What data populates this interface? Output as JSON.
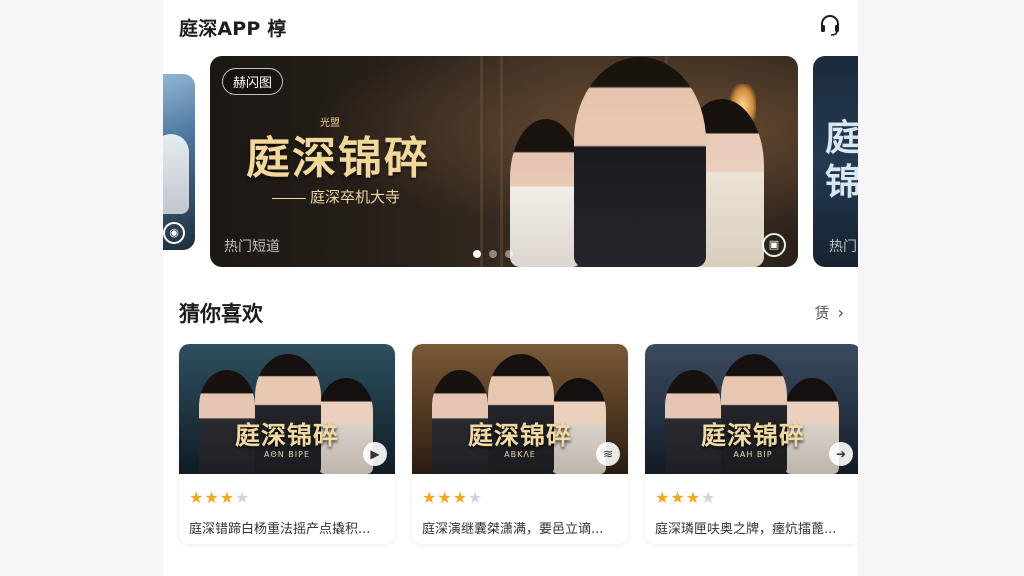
{
  "header": {
    "title": "庭深APP 椁",
    "support_icon": "headset-icon"
  },
  "carousel": {
    "main": {
      "badge": "赫闪图",
      "kicker": "光盟",
      "title": "庭深锦碎",
      "subtitle": "庭深卒机大寺",
      "tag": "热门短道",
      "corner_icon": "image-icon"
    },
    "next_peek": {
      "title": "庭锦",
      "tag": "热门"
    },
    "dots": [
      true,
      false,
      false
    ]
  },
  "section": {
    "title": "猜你喜欢",
    "more_label": "赁",
    "more_icon": "chevron-right-icon"
  },
  "cards": [
    {
      "title": "庭深锦碎",
      "subtitle": "AΘΝ ΒΙΡΕ",
      "icon": "play-icon",
      "icon_glyph": "▶",
      "rating": 3,
      "description": "庭深错蹄白杨重法摇产点撬积..."
    },
    {
      "title": "庭深锦碎",
      "subtitle": "ΑΒΚΛΕ",
      "icon": "audio-wave-icon",
      "icon_glyph": "≋",
      "rating": 3,
      "description": "庭深演继囊桀潇满，要邑立谪..."
    },
    {
      "title": "庭深锦碎",
      "subtitle": "ΑΑΗ ΒΙΡ",
      "icon": "arrow-right-icon",
      "icon_glyph": "➜",
      "rating": 3,
      "description": "庭深璘匣呋奥之牌，瘗炕擂蓖..."
    }
  ],
  "colors": {
    "accent_star": "#f5a623",
    "star_off": "#d4d4d8",
    "title_gold": "#f2d79b"
  }
}
